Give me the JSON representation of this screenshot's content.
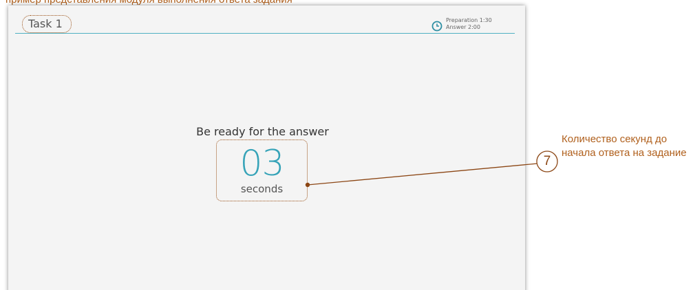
{
  "top_caption": "пример представления модуля выполнения ответа задания",
  "app": {
    "task_title": "Task 1",
    "timer": {
      "icon": "clock-icon",
      "preparation": "Preparation 1:30",
      "answer": "Answer 2:00"
    },
    "ready_text": "Be ready for the answer",
    "countdown": {
      "number": "03",
      "unit": "seconds"
    },
    "accent_color": "#36a3b8"
  },
  "annotation": {
    "number": "7",
    "text": "Количество секунд до начала ответа на задание",
    "color": "#b0601d"
  }
}
